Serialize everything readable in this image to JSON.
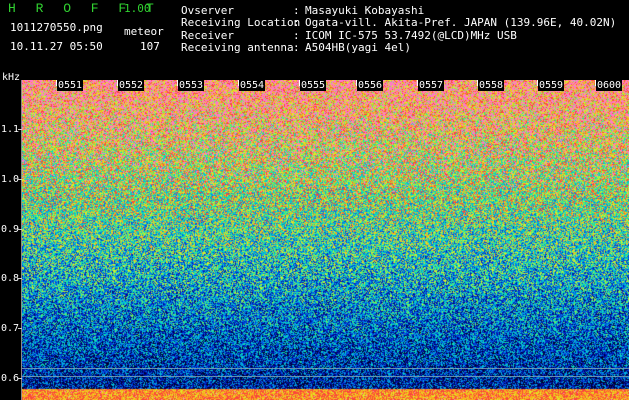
{
  "header": {
    "app_title": "H R O F F T",
    "app_version": "1.00",
    "filename": "1011270550.png",
    "timestamp": "10.11.27 05:50",
    "mode": "meteor",
    "count": "107"
  },
  "info": [
    {
      "label": "Ovserver",
      "value": "Masayuki Kobayashi"
    },
    {
      "label": "Receiving Location",
      "value": "Ogata-vill. Akita-Pref. JAPAN (139.96E, 40.02N)"
    },
    {
      "label": "Receiver",
      "value": "ICOM IC-575 53.7492(@LCD)MHz USB"
    },
    {
      "label": "Receiving antenna",
      "value": "A504HB(yagi 4el)"
    }
  ],
  "colon": ":",
  "axis": {
    "unit": "kHz",
    "freq_labels": [
      "1.1",
      "1.0",
      "0.9",
      "0.8",
      "0.7",
      "0.6"
    ],
    "time_labels": [
      "0551",
      "0552",
      "0553",
      "0554",
      "0555",
      "0556",
      "0557",
      "0558",
      "0559",
      "0600"
    ]
  }
}
